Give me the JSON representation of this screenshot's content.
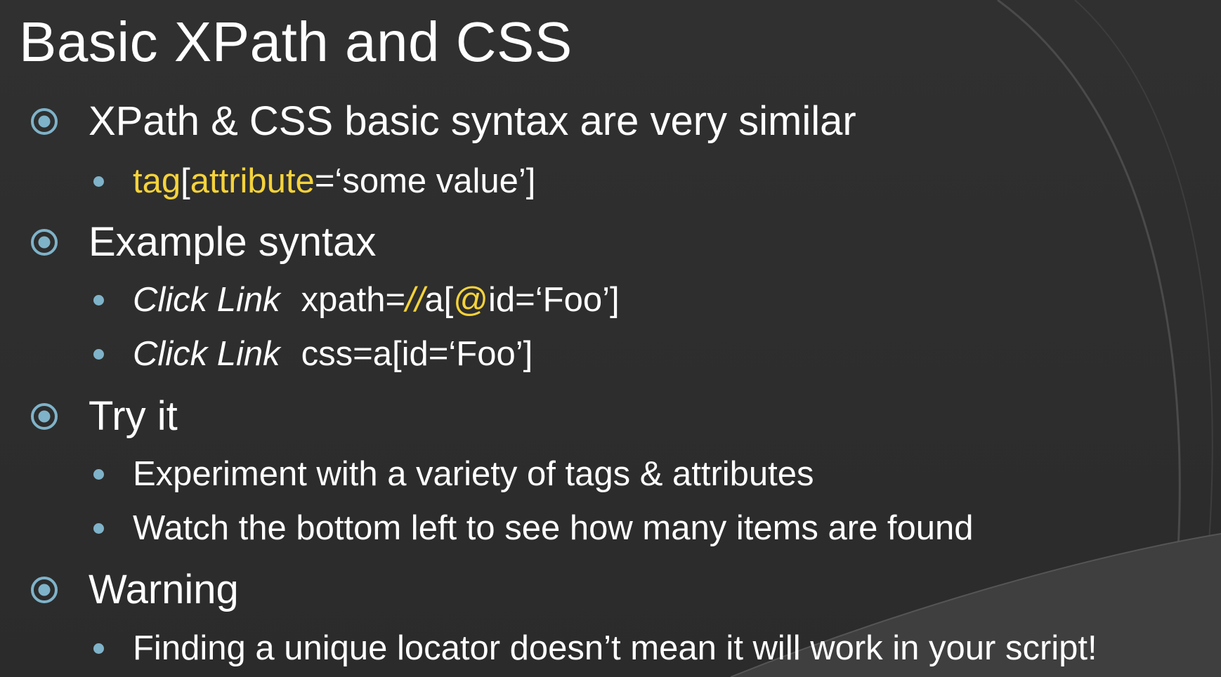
{
  "slide": {
    "title": "Basic XPath and CSS",
    "colors": {
      "background": "#2e2e2e",
      "text": "#ffffff",
      "highlight": "#f5d33a",
      "bullet": "#7fb3c9"
    },
    "sections": [
      {
        "heading": "XPath & CSS basic syntax are very similar",
        "syntax": {
          "tag": "tag",
          "open_bracket": "[",
          "attribute": "attribute",
          "rest": "=‘some value’]"
        }
      },
      {
        "heading": "Example syntax",
        "examples": [
          {
            "keyword": "Click Link",
            "prefix": "xpath=",
            "slashes": "//",
            "mid": "a[",
            "at": "@",
            "suffix": "id=‘Foo’]"
          },
          {
            "keyword": "Click Link",
            "locator": "css=a[id=‘Foo’]"
          }
        ]
      },
      {
        "heading": "Try it",
        "items": [
          "Experiment with a variety of tags & attributes",
          "Watch the bottom left to see how many items are found"
        ]
      },
      {
        "heading": "Warning",
        "items": [
          "Finding a unique locator doesn’t mean it will work in your script!"
        ]
      }
    ]
  }
}
